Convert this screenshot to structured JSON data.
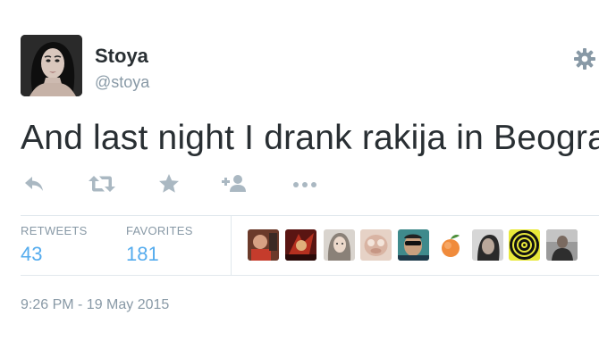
{
  "author": {
    "display_name": "Stoya",
    "screen_name": "@stoya"
  },
  "tweet": {
    "text": "And last night I drank rakija in Beograd.",
    "timestamp": "9:26 PM - 19 May 2015"
  },
  "actions": [
    {
      "name": "reply-icon"
    },
    {
      "name": "retweet-icon"
    },
    {
      "name": "favorite-star-icon"
    },
    {
      "name": "follow-icon"
    },
    {
      "name": "more-icon"
    }
  ],
  "stats": {
    "retweets_label": "RETWEETS",
    "retweets_count": "43",
    "favorites_label": "FAVORITES",
    "favorites_count": "181"
  },
  "favorited_by_count_shown": 9,
  "colors": {
    "text": "#292f33",
    "muted": "#8899a6",
    "accent": "#55acee",
    "divider": "#e1e8ed",
    "icon": "#aab8c2"
  }
}
